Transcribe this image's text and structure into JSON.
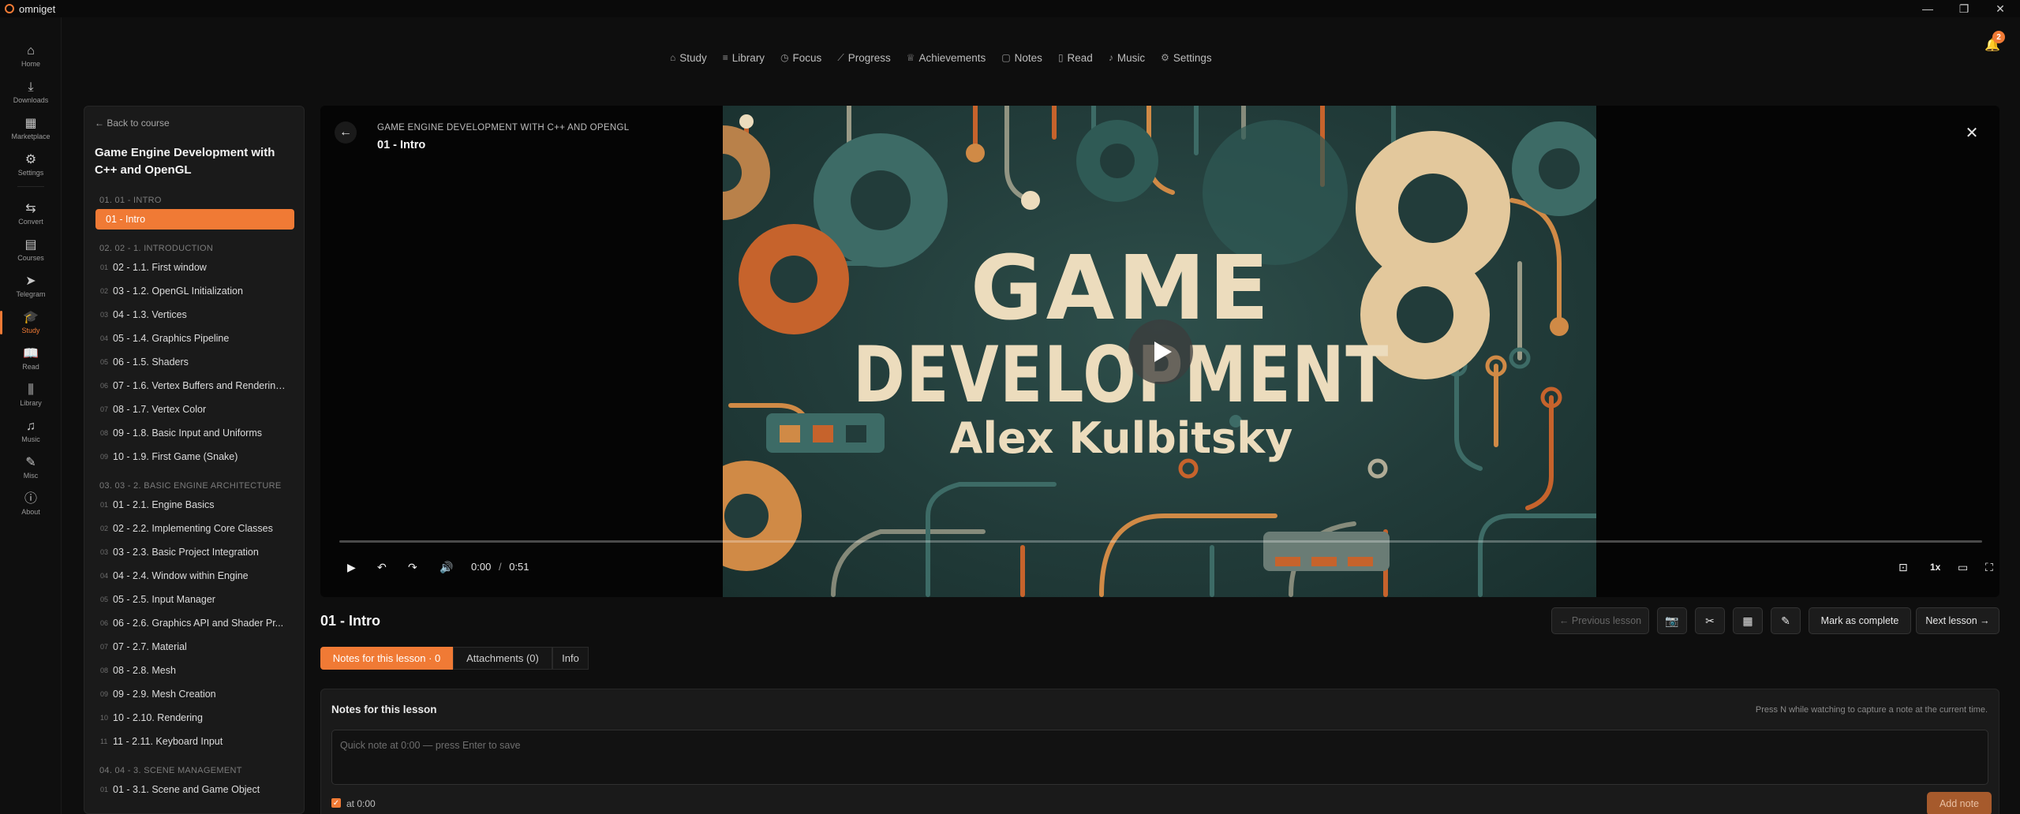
{
  "window": {
    "app_title": "omniget",
    "minimize": "—",
    "maximize": "❐",
    "close": "✕"
  },
  "rail": [
    {
      "key": "home",
      "label": "Home",
      "icon": "⌂"
    },
    {
      "key": "downloads",
      "label": "Downloads",
      "icon": "⤓"
    },
    {
      "key": "marketplace",
      "label": "Marketplace",
      "icon": "▦"
    },
    {
      "key": "settings",
      "label": "Settings",
      "icon": "⚙"
    },
    {
      "key": "convert",
      "label": "Convert",
      "icon": "⇆"
    },
    {
      "key": "courses",
      "label": "Courses",
      "icon": "▤"
    },
    {
      "key": "telegram",
      "label": "Telegram",
      "icon": "➤"
    },
    {
      "key": "study",
      "label": "Study",
      "icon": "🎓"
    },
    {
      "key": "read",
      "label": "Read",
      "icon": "📖"
    },
    {
      "key": "library",
      "label": "Library",
      "icon": "⫼"
    },
    {
      "key": "music",
      "label": "Music",
      "icon": "♫"
    },
    {
      "key": "misc",
      "label": "Misc",
      "icon": "✎"
    },
    {
      "key": "about",
      "label": "About",
      "icon": "ⓘ"
    }
  ],
  "topnav": [
    {
      "label": "Study",
      "icon": "⌂"
    },
    {
      "label": "Library",
      "icon": "≡"
    },
    {
      "label": "Focus",
      "icon": "◷"
    },
    {
      "label": "Progress",
      "icon": "⟋"
    },
    {
      "label": "Achievements",
      "icon": "♕"
    },
    {
      "label": "Notes",
      "icon": "▢"
    },
    {
      "label": "Read",
      "icon": "▯"
    },
    {
      "label": "Music",
      "icon": "♪"
    },
    {
      "label": "Settings",
      "icon": "⚙"
    }
  ],
  "notifications": {
    "count": "2"
  },
  "course": {
    "back_label": "← Back to course",
    "title": "Game Engine Development with C++ and OpenGL",
    "sections": [
      {
        "heading": "01. 01 - INTRO",
        "lessons": [
          {
            "num": "",
            "title": "01 - Intro",
            "active": true
          }
        ]
      },
      {
        "heading": "02. 02 - 1. INTRODUCTION",
        "lessons": [
          {
            "num": "01",
            "title": "02 - 1.1. First window"
          },
          {
            "num": "02",
            "title": "03 - 1.2. OpenGL Initialization"
          },
          {
            "num": "03",
            "title": "04 - 1.3. Vertices"
          },
          {
            "num": "04",
            "title": "05 - 1.4. Graphics Pipeline"
          },
          {
            "num": "05",
            "title": "06 - 1.5. Shaders"
          },
          {
            "num": "06",
            "title": "07 - 1.6. Vertex Buffers and Rendering..."
          },
          {
            "num": "07",
            "title": "08 - 1.7. Vertex Color"
          },
          {
            "num": "08",
            "title": "09 - 1.8. Basic Input and Uniforms"
          },
          {
            "num": "09",
            "title": "10 - 1.9. First Game (Snake)"
          }
        ]
      },
      {
        "heading": "03. 03 - 2. BASIC ENGINE ARCHITECTURE",
        "lessons": [
          {
            "num": "01",
            "title": "01 - 2.1. Engine Basics"
          },
          {
            "num": "02",
            "title": "02 - 2.2. Implementing Core Classes"
          },
          {
            "num": "03",
            "title": "03 - 2.3. Basic Project Integration"
          },
          {
            "num": "04",
            "title": "04 - 2.4. Window within Engine"
          },
          {
            "num": "05",
            "title": "05 - 2.5. Input Manager"
          },
          {
            "num": "06",
            "title": "06 - 2.6. Graphics API and Shader Pr..."
          },
          {
            "num": "07",
            "title": "07 - 2.7. Material"
          },
          {
            "num": "08",
            "title": "08 - 2.8. Mesh"
          },
          {
            "num": "09",
            "title": "09 - 2.9. Mesh Creation"
          },
          {
            "num": "10",
            "title": "10 - 2.10. Rendering"
          },
          {
            "num": "11",
            "title": "11 - 2.11. Keyboard Input"
          }
        ]
      },
      {
        "heading": "04. 04 - 3. SCENE MANAGEMENT",
        "lessons": [
          {
            "num": "01",
            "title": "01 - 3.1. Scene and Game Object"
          }
        ]
      }
    ]
  },
  "video": {
    "course_label": "GAME ENGINE DEVELOPMENT WITH C++ AND OPENGL",
    "lesson_label": "01 - Intro",
    "thumb_line1": "GAME",
    "thumb_line2": "DEVELOPMENT",
    "thumb_author": "Alex Kulbitsky",
    "current_time": "0:00",
    "time_sep": "/",
    "duration": "0:51",
    "progress": 0.0,
    "speed_label": "1x",
    "colors": {
      "accent": "#f07a35",
      "thumb_bg": "#223c3a",
      "cream": "#ecdcbd",
      "rust": "#c6632c",
      "teal": "#3d6b66"
    }
  },
  "lesson": {
    "title": "01 - Intro",
    "prev_label": "← Previous lesson",
    "mark_label": "Mark as complete",
    "next_label": "Next lesson →"
  },
  "tabs": [
    {
      "label": "Notes for this lesson · 0",
      "active": true
    },
    {
      "label": "Attachments (0)"
    },
    {
      "label": "Info"
    }
  ],
  "notes": {
    "heading": "Notes for this lesson",
    "hint": "Press N while watching to capture a note at the current time.",
    "placeholder": "Quick note at 0:00 — press Enter to save",
    "value": "",
    "timestamp_label": "at 0:00",
    "add_label": "Add note"
  }
}
